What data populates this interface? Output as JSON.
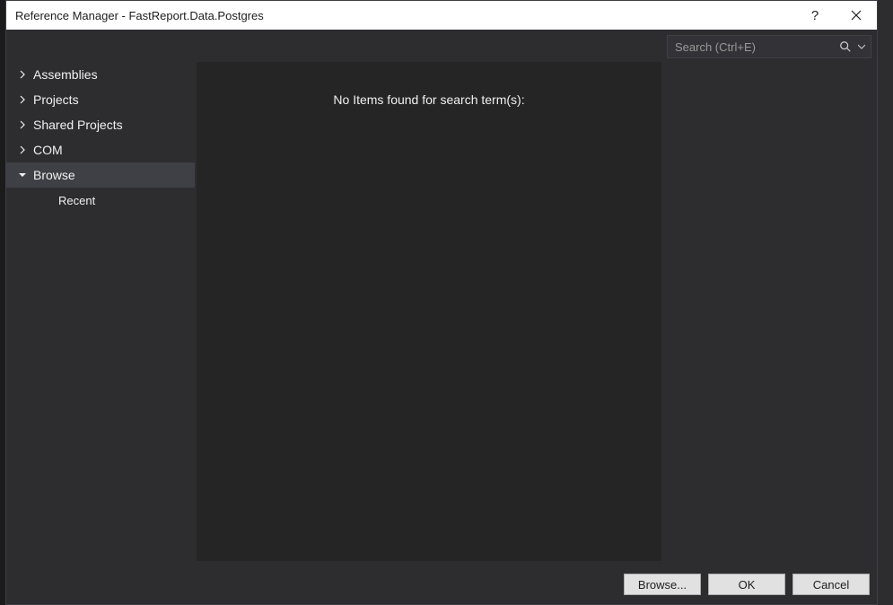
{
  "titlebar": {
    "title": "Reference Manager - FastReport.Data.Postgres"
  },
  "search": {
    "placeholder": "Search (Ctrl+E)"
  },
  "sidebar": {
    "items": [
      {
        "label": "Assemblies",
        "expanded": false,
        "selected": false
      },
      {
        "label": "Projects",
        "expanded": false,
        "selected": false
      },
      {
        "label": "Shared Projects",
        "expanded": false,
        "selected": false
      },
      {
        "label": "COM",
        "expanded": false,
        "selected": false
      },
      {
        "label": "Browse",
        "expanded": true,
        "selected": true
      }
    ],
    "browse_children": [
      {
        "label": "Recent"
      }
    ]
  },
  "content": {
    "empty_message": "No Items found for search term(s):"
  },
  "buttons": {
    "browse": "Browse...",
    "ok": "OK",
    "cancel": "Cancel"
  }
}
